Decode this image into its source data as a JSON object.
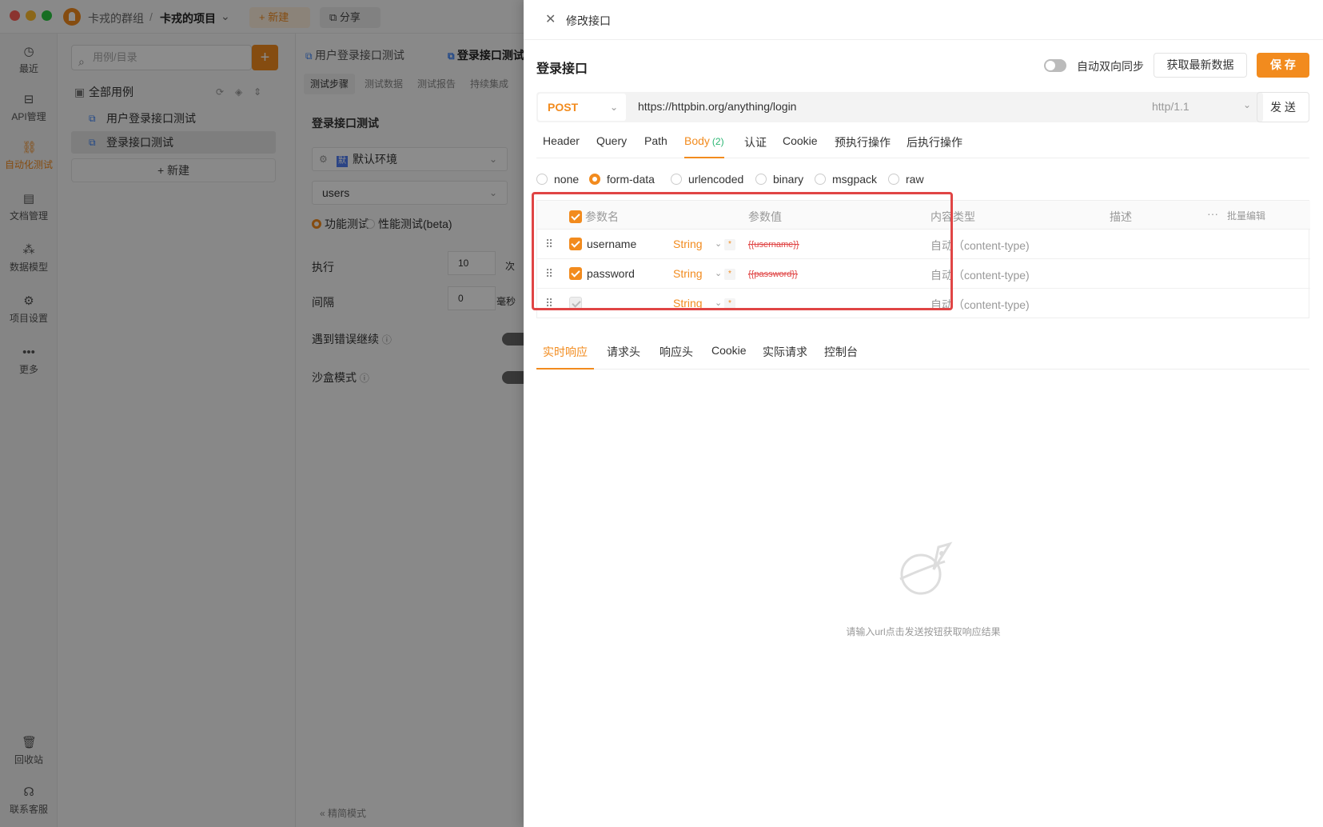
{
  "titlebar": {
    "group": "卡戎的群组",
    "sep": "/",
    "project": "卡戎的项目",
    "new_btn": "+ 新建",
    "share_btn": "分享"
  },
  "leftnav": {
    "items": [
      {
        "label": "最近",
        "icon": "clock-icon"
      },
      {
        "label": "API管理",
        "icon": "api-icon"
      },
      {
        "label": "自动化测试",
        "icon": "automation-icon",
        "active": true
      },
      {
        "label": "文档管理",
        "icon": "document-icon"
      },
      {
        "label": "数据模型",
        "icon": "data-model-icon"
      },
      {
        "label": "项目设置",
        "icon": "settings-icon"
      },
      {
        "label": "更多",
        "icon": "more-icon"
      },
      {
        "label": "回收站",
        "icon": "trash-icon"
      },
      {
        "label": "联系客服",
        "icon": "headset-icon"
      }
    ]
  },
  "tree": {
    "search_placeholder": "用例/目录",
    "add": "+",
    "root": "全部用例",
    "items": [
      "用户登录接口测试",
      "登录接口测试"
    ],
    "new": "+ 新建"
  },
  "middle": {
    "tabs": [
      "用户登录接口测试",
      "登录接口测试"
    ],
    "sub_tabs": [
      "测试步骤",
      "测试数据",
      "测试报告",
      "持续集成"
    ],
    "title": "登录接口测试",
    "env_badge": "默",
    "env": "默认环境",
    "dataset": "users",
    "mode_functional": "功能测试",
    "mode_perf": "性能测试(beta)",
    "exec_label": "执行",
    "exec_value": "10",
    "exec_unit": "次",
    "interval_label": "间隔",
    "interval_value": "0",
    "interval_unit": "毫秒",
    "continue_on_error": "遇到错误继续",
    "sandbox": "沙盒模式",
    "compact_mode": "精简模式"
  },
  "drawer": {
    "title": "修改接口",
    "api_name": "登录接口",
    "sync_label": "自动双向同步",
    "fetch_btn": "获取最新数据",
    "save_btn": "保 存",
    "method": "POST",
    "url": "https://httpbin.org/anything/login",
    "protocol": "http/1.1",
    "send_btn": "发 送",
    "req_tabs": [
      "Header",
      "Query",
      "Path",
      "Body",
      "认证",
      "Cookie",
      "预执行操作",
      "后执行操作"
    ],
    "body_count": "(2)",
    "body_types": [
      "none",
      "form-data",
      "urlencoded",
      "binary",
      "msgpack",
      "raw"
    ],
    "selected_body_type": "form-data",
    "param_headers": {
      "name": "参数名",
      "value": "参数值",
      "ctype": "内容类型",
      "desc": "描述",
      "bulk": "批量编辑",
      "more": "···"
    },
    "params": [
      {
        "name": "username",
        "type": "String",
        "value": "{{username}}",
        "ctype": "自动（content-type)"
      },
      {
        "name": "password",
        "type": "String",
        "value": "{{password}}",
        "ctype": "自动（content-type)"
      },
      {
        "name": "",
        "type": "String",
        "value": "",
        "ctype": "自动（content-type)"
      }
    ],
    "resp_tabs": [
      "实时响应",
      "请求头",
      "响应头",
      "Cookie",
      "实际请求",
      "控制台"
    ],
    "empty_text": "请输入url点击发送按钮获取响应结果"
  },
  "colors": {
    "accent": "#f28b1e",
    "highlight": "#e04545"
  }
}
